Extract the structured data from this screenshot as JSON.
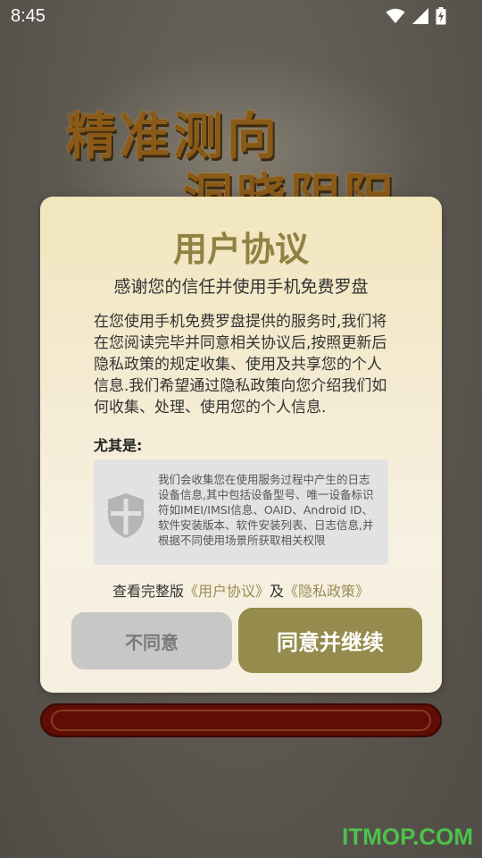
{
  "status_bar": {
    "time": "8:45"
  },
  "background": {
    "line1": "精准测向",
    "line2": "洞晓阴阳"
  },
  "dialog": {
    "title": "用户协议",
    "subtitle": "感谢您的信任并使用手机免费罗盘",
    "body": "在您使用手机免费罗盘提供的服务时,我们将在您阅读完毕并同意相关协议后,按照更新后隐私政策的规定收集、使用及共享您的个人信息.我们希望通过隐私政策向您介绍我们如何收集、处理、使用您的个人信息.",
    "emphasis_label": "尤其是:",
    "info_text": "我们会收集您在使用服务过程中产生的日志 设备信息,其中包括设备型号、唯一设备标识符如IMEI/IMSI信息、OAID、Android ID、软件安装版本、软件安装列表、日志信息,并根据不同使用场景所获取相关权限",
    "links_prefix": "查看完整版",
    "user_agreement_link": "《用户协议》",
    "links_joiner": "及",
    "privacy_policy_link": "《隐私政策》",
    "disagree_label": "不同意",
    "agree_label": "同意并继续"
  },
  "watermark": "ITMOP.COM",
  "colors": {
    "accent": "#958b4c",
    "title": "#8f8344",
    "link": "#9a8c55",
    "red_bar": "#5e0e04",
    "watermark": "#4cc24c"
  }
}
